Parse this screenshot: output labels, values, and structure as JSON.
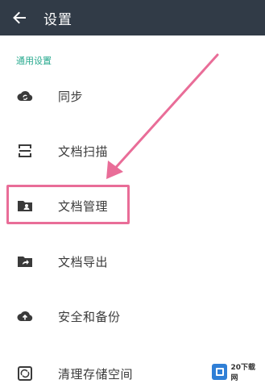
{
  "appbar": {
    "title": "设置",
    "back_icon": "arrow-left-icon"
  },
  "section": {
    "label": "通用设置"
  },
  "items": [
    {
      "label": "同步",
      "icon": "cloud-sync-icon"
    },
    {
      "label": "文档扫描",
      "icon": "scan-icon"
    },
    {
      "label": "文档管理",
      "icon": "folder-person-icon"
    },
    {
      "label": "文档导出",
      "icon": "folder-export-icon"
    },
    {
      "label": "安全和备份",
      "icon": "cloud-upload-icon"
    },
    {
      "label": "清理存储空间",
      "icon": "clean-storage-icon"
    }
  ],
  "annotation": {
    "highlight_color": "#e96d98",
    "highlighted_item": "文档管理"
  },
  "watermark": {
    "text": "20下载网",
    "logo_color": "#2f7fd6"
  },
  "colors": {
    "appbar": "#313b47",
    "accent": "#26a98e",
    "icon": "#3a3a3a"
  }
}
